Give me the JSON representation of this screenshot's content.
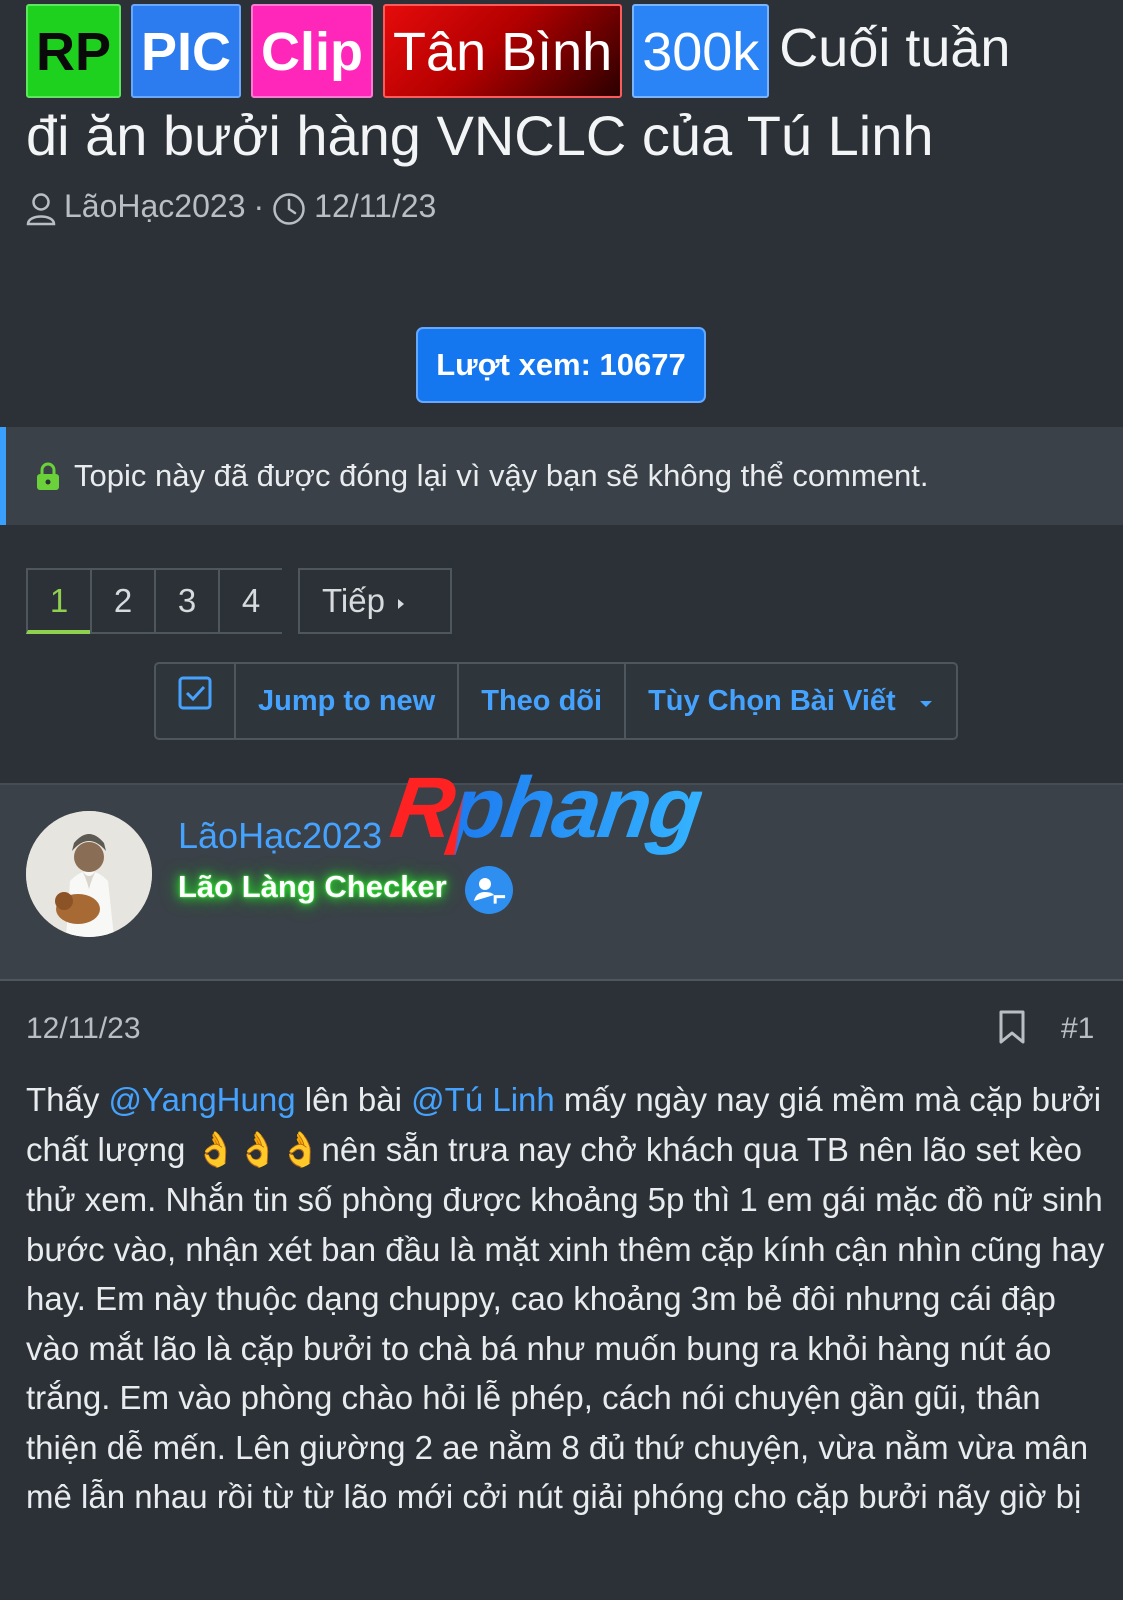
{
  "thread": {
    "prefixes": [
      "RP",
      "PIC",
      "Clip",
      "Tân Bình",
      "300k"
    ],
    "title_part1": "Cuối tuần",
    "title_part2": "đi ăn bưởi hàng VNCLC của Tú Linh",
    "author": "LãoHạc2023",
    "date": "12/11/23"
  },
  "views_label": "Lượt xem: 10677",
  "locked_notice": "Topic này đã được đóng lại vì vậy bạn sẽ không thể comment.",
  "pagination": {
    "pages": [
      "1",
      "2",
      "3",
      "4"
    ],
    "active": "1",
    "next_label": "Tiếp"
  },
  "actions": {
    "jump": "Jump to new",
    "watch": "Theo dõi",
    "options": "Tùy Chọn Bài Viết"
  },
  "watermark": "Rphang",
  "post": {
    "username": "LãoHạc2023",
    "user_title": "Lão Làng Checker",
    "date": "12/11/23",
    "number": "#1",
    "body": {
      "t1": "Thấy ",
      "mention1": "@YangHung",
      "t2": " lên bài ",
      "mention2": "@Tú Linh",
      "t3": " mấy ngày nay giá mềm mà cặp bưởi chất lượng ",
      "emoji": "👌👌👌",
      "t4": "nên sẵn trưa nay chở khách qua TB nên lão set kèo thử xem. Nhắn tin số phòng được khoảng 5p thì 1 em gái mặc đồ nữ sinh bước vào, nhận xét ban đầu là mặt xinh thêm cặp kính cận nhìn cũng hay hay. Em này thuộc dạng chuppy, cao khoảng 3m bẻ đôi nhưng cái đập vào mắt lão là cặp bưởi to chà bá như muốn bung ra khỏi hàng nút áo trắng. Em vào phòng chào hỏi lễ phép, cách nói chuyện gần gũi, thân thiện dễ mến. Lên giường 2 ae nằm 8 đủ thứ chuyện, vừa nằm vừa mân mê lẫn nhau rồi từ từ lão mới cởi nút giải phóng cho cặp bưởi nãy giờ bị"
    }
  },
  "colors": {
    "accent_blue": "#45a3ff",
    "active_page": "#8fd14f",
    "glow_green": "#2dff2d"
  }
}
